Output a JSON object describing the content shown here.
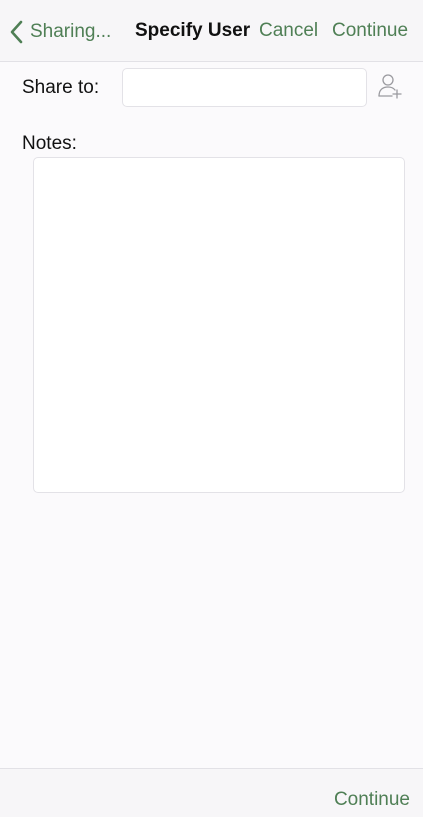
{
  "nav": {
    "back_label": "Sharing...",
    "title": "Specify User",
    "cancel_label": "Cancel",
    "continue_label": "Continue"
  },
  "form": {
    "share_to_label": "Share to:",
    "share_to_value": "",
    "share_to_placeholder": "",
    "notes_label": "Notes:",
    "notes_value": ""
  },
  "toolbar": {
    "continue_label": "Continue"
  },
  "icons": {
    "back": "chevron-left-icon",
    "add_user": "add-user-icon"
  },
  "colors": {
    "accent": "#4f7f55",
    "background": "#fbfafc",
    "bar_background": "#f7f6f8",
    "border": "#e3e2e7",
    "icon_gray": "#9a9a9f"
  }
}
